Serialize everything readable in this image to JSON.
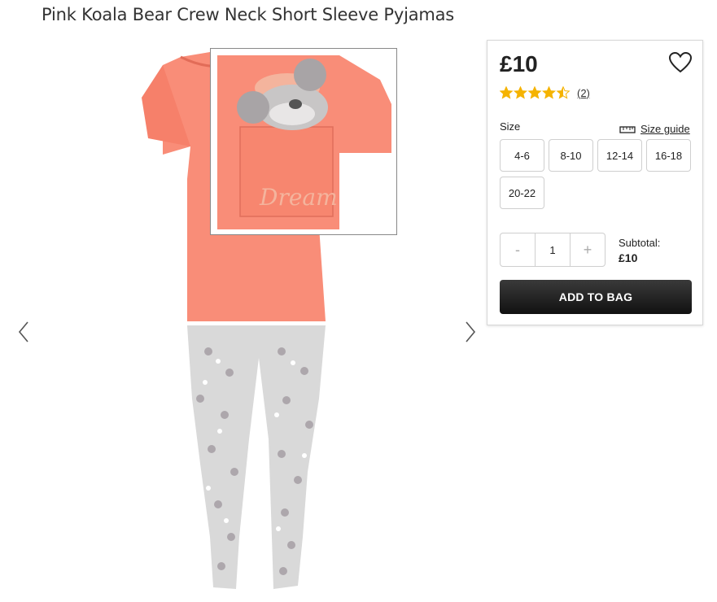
{
  "product": {
    "title": "Pink Koala Bear Crew Neck Short Sleeve Pyjamas",
    "price": "£10",
    "rating": 4.5,
    "rating_max": 5,
    "review_count": "(2)",
    "pocket_text": "Dream",
    "colors": {
      "top": "#f98d78",
      "bottoms": "#d9d9d9",
      "star": "#f5b301"
    }
  },
  "size": {
    "label": "Size",
    "guide_label": "Size guide",
    "options": [
      "4-6",
      "8-10",
      "12-14",
      "16-18",
      "20-22"
    ]
  },
  "quantity": {
    "minus": "-",
    "value": "1",
    "plus": "+"
  },
  "subtotal": {
    "label": "Subtotal:",
    "value": "£10"
  },
  "cta": {
    "add_to_bag": "ADD TO BAG"
  },
  "icons": [
    "chevron-left-icon",
    "chevron-right-icon",
    "heart-icon",
    "star-icon",
    "ruler-icon"
  ]
}
